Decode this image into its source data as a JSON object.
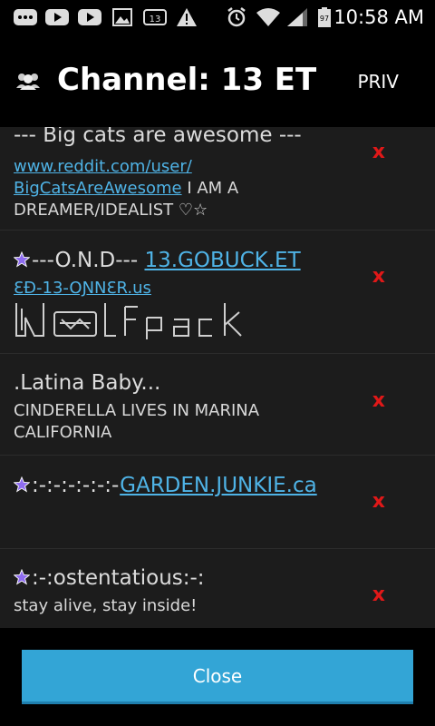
{
  "status_bar": {
    "time": "10:58 AM",
    "battery_level": "97",
    "icons": [
      "messages-icon",
      "youtube-icon",
      "youtube-icon",
      "gallery-icon",
      "voicemail-icon",
      "warning-icon",
      "alarm-icon",
      "wifi-icon",
      "signal-icon",
      "battery-icon"
    ]
  },
  "header": {
    "title": "Channel: 13 ET",
    "priv_label": "PRIV",
    "icon": "users-icon"
  },
  "items": [
    {
      "name": "--- Big cats are awesome ---",
      "link": "www.reddit.com/user/ BigCatsAreAwesome",
      "desc_after_link": " I AM A DREAMER/IDEALIST ♡☆",
      "remove": "x"
    },
    {
      "name": "---O.N.D---",
      "name_link": "13.GOBUCK.ET",
      "line2": "ƐƉ-13-OƝNƐR.us",
      "art_text": "Wolfpack",
      "remove": "x"
    },
    {
      "name": ".Latina Baby...",
      "desc": "CINDERELLA LIVES IN MARINA CALIFORNIA",
      "remove": "x"
    },
    {
      "name": ":-:-:-:-:-:-",
      "name_link": "GARDEN.JUNKIE.ca",
      "remove": "x"
    },
    {
      "name": ":-:ostentatious:-:",
      "desc": "stay alive, stay inside!",
      "remove": "x"
    }
  ],
  "footer": {
    "close_label": "Close"
  },
  "colors": {
    "accent": "#33a5d6",
    "link": "#4fb3e6",
    "remove": "#e01818",
    "star": "#7b5cd6",
    "list_bg": "#1c1c1c"
  }
}
